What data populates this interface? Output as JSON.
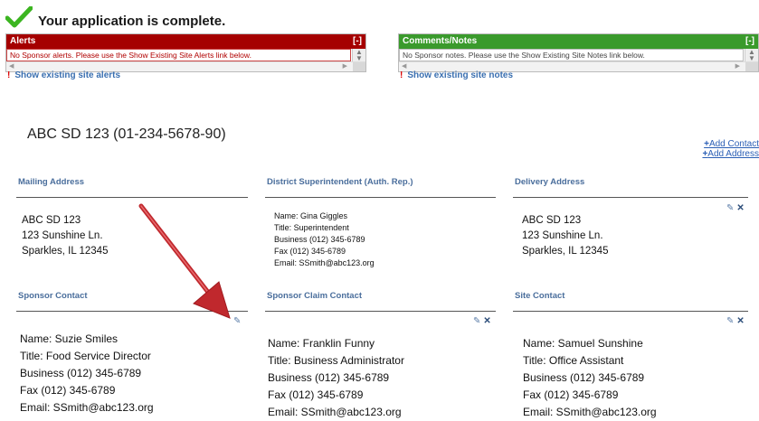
{
  "status": {
    "message": "Your application is complete."
  },
  "alerts": {
    "title": "Alerts",
    "toggle": "[-]",
    "text": "No Sponsor alerts. Please use the Show Existing Site Alerts link below.",
    "link": "Show existing site alerts"
  },
  "notes": {
    "title": "Comments/Notes",
    "toggle": "[-]",
    "text": "No Sponsor notes. Please use the Show Existing Site Notes link below.",
    "link": "Show existing site notes"
  },
  "org": {
    "title": "ABC SD 123 (01-234-5678-90)",
    "add_contact": "Add Contact",
    "add_address": "Add Address"
  },
  "mailing": {
    "heading": "Mailing Address",
    "lines": [
      "ABC SD 123",
      "123 Sunshine Ln.",
      "Sparkles, IL 12345"
    ]
  },
  "superintendent": {
    "heading": "District Superintendent (Auth. Rep.)",
    "lines": [
      "Name:  Gina Giggles",
      "Title:  Superintendent",
      "Business (012) 345-6789",
      "Fax (012) 345-6789",
      "Email: SSmith@abc123.org"
    ]
  },
  "delivery": {
    "heading": "Delivery Address",
    "lines": [
      "ABC SD 123",
      "123 Sunshine Ln.",
      "Sparkles, IL 12345"
    ]
  },
  "sponsor_contact": {
    "heading": "Sponsor Contact",
    "lines": [
      "Name:  Suzie Smiles",
      "Title: Food Service Director",
      "Business (012) 345-6789",
      "Fax (012) 345-6789",
      "Email: SSmith@abc123.org"
    ]
  },
  "claim_contact": {
    "heading": "Sponsor Claim Contact",
    "lines": [
      "Name:   Franklin Funny",
      "Title: Business Administrator",
      "Business (012) 345-6789",
      "Fax (012) 345-6789",
      "Email: SSmith@abc123.org"
    ]
  },
  "site_contact": {
    "heading": "Site Contact",
    "lines": [
      "Name: Samuel Sunshine",
      "Title: Office Assistant",
      "Business (012) 345-6789",
      "Fax (012) 345-6789",
      "Email: SSmith@abc123.org"
    ]
  },
  "icons": {
    "edit": "pencil-icon",
    "delete": "x-icon",
    "arrow": "annotation-arrow",
    "check": "checkmark-icon"
  },
  "colors": {
    "alerts_header": "#a50000",
    "notes_header": "#3a9a2c",
    "link": "#2b5fb5",
    "arrow": "#c0282d"
  }
}
